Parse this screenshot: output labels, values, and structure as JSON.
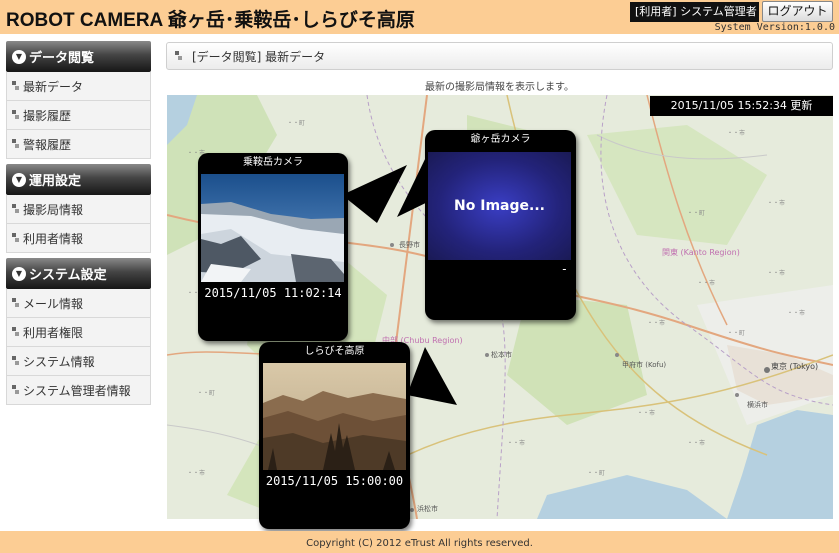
{
  "header": {
    "title": "ROBOT CAMERA 爺ヶ岳･乗鞍岳･しらびそ高原",
    "user_badge": "[利用者] システム管理者",
    "logout_label": "ログアウト",
    "version": "System Version:1.0.0"
  },
  "sidebar": {
    "sections": [
      {
        "title": "データ閲覧",
        "items": [
          "最新データ",
          "撮影履歴",
          "警報履歴"
        ]
      },
      {
        "title": "運用設定",
        "items": [
          "撮影局情報",
          "利用者情報"
        ]
      },
      {
        "title": "システム設定",
        "items": [
          "メール情報",
          "利用者権限",
          "システム情報",
          "システム管理者情報"
        ]
      }
    ]
  },
  "main": {
    "breadcrumb": "[データ閲覧] 最新データ",
    "info": "最新の撮影局情報を表示します。",
    "updated": "2015/11/05 15:52:34 更新"
  },
  "cameras": {
    "norikura": {
      "name": "乗鞍岳カメラ",
      "time": "2015/11/05 11:02:14"
    },
    "jii": {
      "name": "爺ヶ岳カメラ",
      "image_text": "No Image...",
      "time": "-"
    },
    "shirabiso": {
      "name": "しらびそ高原",
      "time": "2015/11/05 15:00:00"
    }
  },
  "map_labels": {
    "kanto": "関東 (Kanto Region)",
    "chubu": "中部 (Chubu Region)",
    "tokyo": "東京 (Tokyo)",
    "yokohama": "横浜市",
    "kofu": "甲府市 (Kofu)",
    "nagano": "長野市",
    "matsumoto": "松本市",
    "hamamatsu": "浜松市"
  },
  "footer": {
    "copyright": "Copyright (C) 2012 eTrust All rights reserved."
  },
  "colors": {
    "header_bg": "#fccd94",
    "popup_bg": "#000000",
    "noimage_bg": "#2a2fa0"
  }
}
